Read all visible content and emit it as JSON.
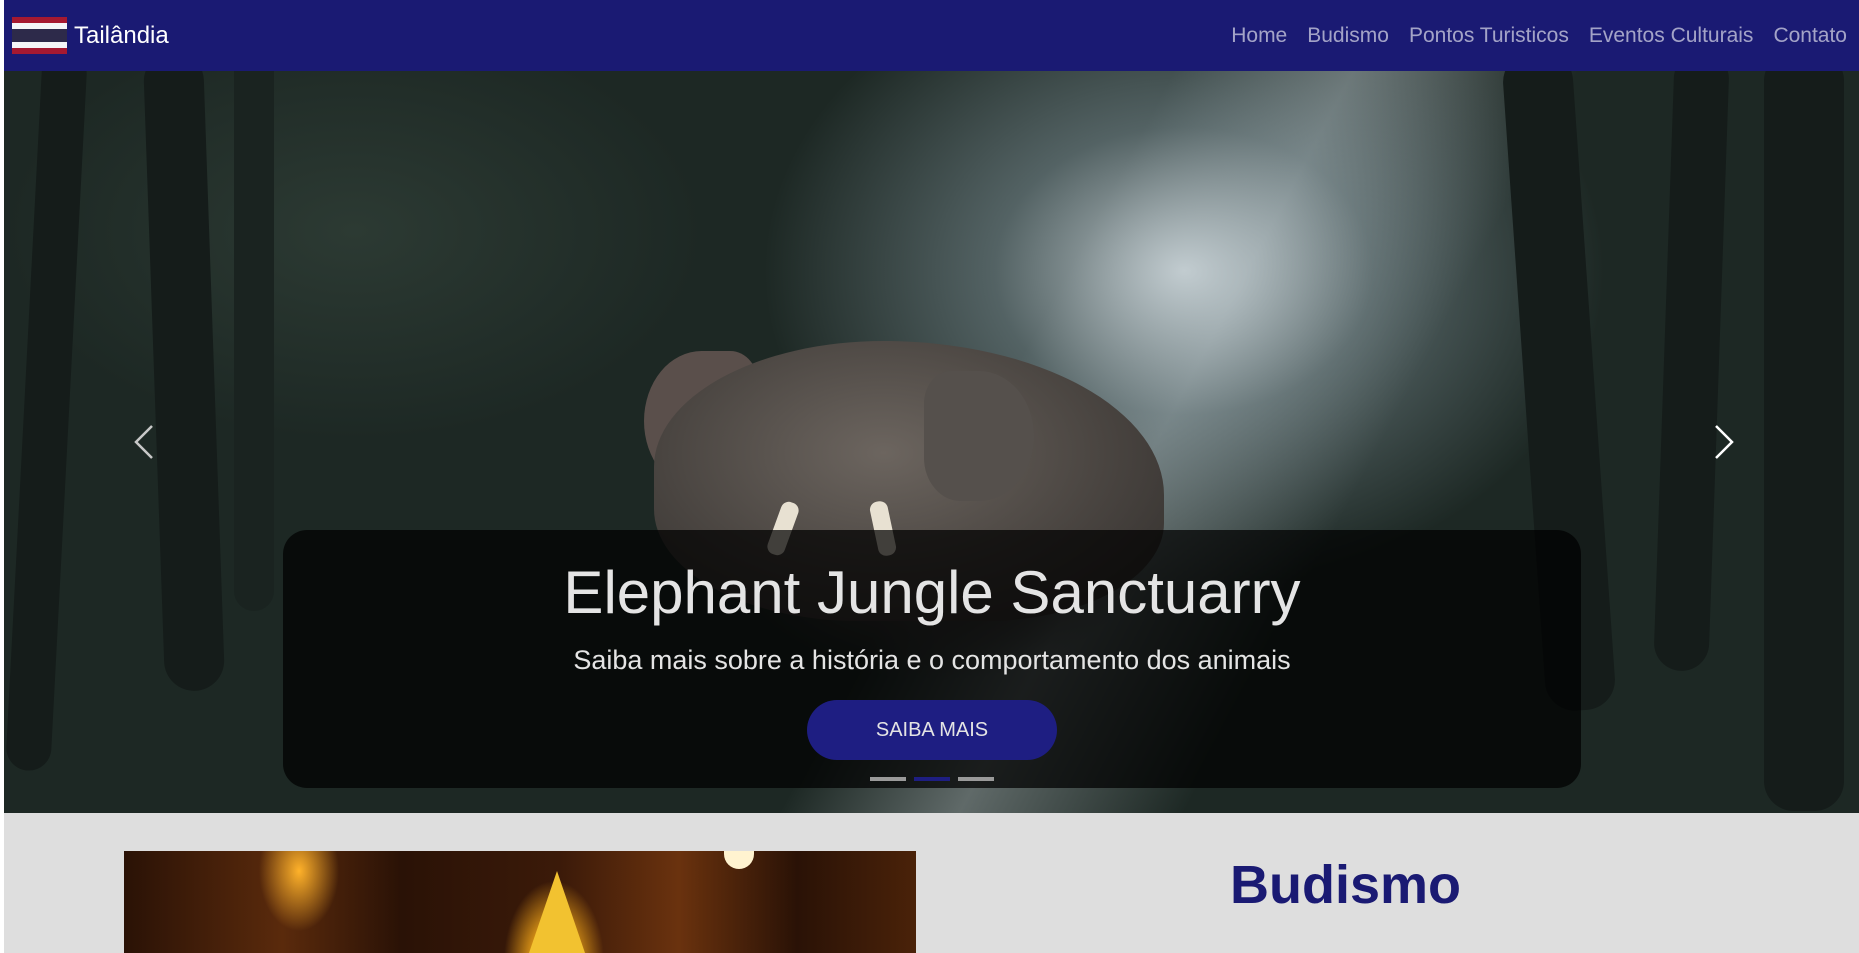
{
  "navbar": {
    "brand": "Tailândia",
    "flag_colors": [
      "#a51931",
      "#f4f5f8",
      "#2d2a4a"
    ],
    "links": [
      {
        "label": "Home"
      },
      {
        "label": "Budismo"
      },
      {
        "label": "Pontos Turisticos"
      },
      {
        "label": "Eventos Culturais"
      },
      {
        "label": "Contato"
      }
    ]
  },
  "carousel": {
    "slide": {
      "title": "Elephant Jungle Sanctuarry",
      "text": "Saiba mais sobre a história e o comportamento dos animais",
      "button_label": "SAIBA MAIS"
    },
    "slide_count": 3,
    "active_index": 1,
    "prev_icon": "chevron-left-icon",
    "next_icon": "chevron-right-icon"
  },
  "section": {
    "title": "Budismo"
  },
  "colors": {
    "primary": "#1a1a73",
    "button": "#1e1e82",
    "section_bg": "#dedede"
  }
}
